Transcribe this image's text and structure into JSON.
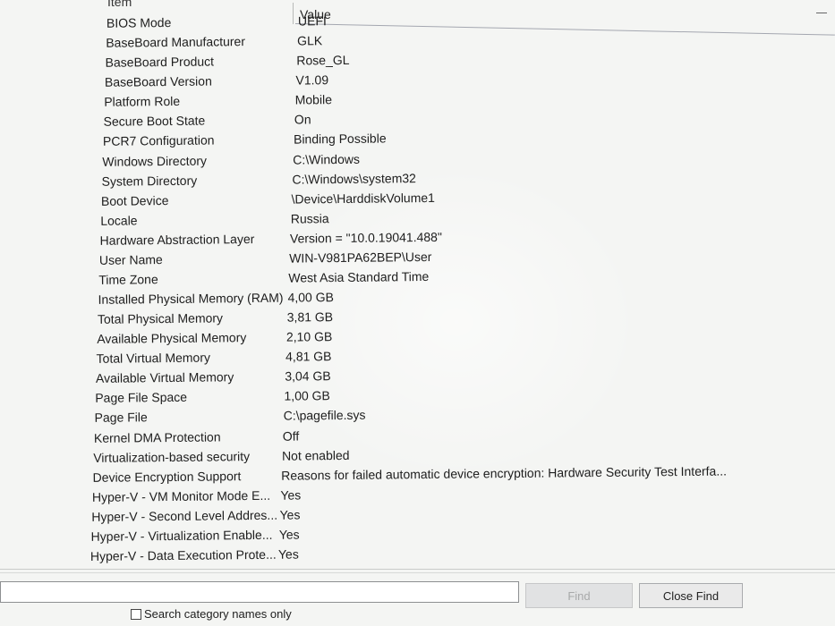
{
  "table": {
    "header_item": "Item",
    "header_value": "Value",
    "rows": [
      {
        "item": "BIOS Mode",
        "value": "UEFI"
      },
      {
        "item": "BaseBoard Manufacturer",
        "value": "GLK"
      },
      {
        "item": "BaseBoard Product",
        "value": "Rose_GL"
      },
      {
        "item": "BaseBoard Version",
        "value": "V1.09"
      },
      {
        "item": "Platform Role",
        "value": "Mobile"
      },
      {
        "item": "Secure Boot State",
        "value": "On"
      },
      {
        "item": "PCR7 Configuration",
        "value": "Binding Possible"
      },
      {
        "item": "Windows Directory",
        "value": "C:\\Windows"
      },
      {
        "item": "System Directory",
        "value": "C:\\Windows\\system32"
      },
      {
        "item": "Boot Device",
        "value": "\\Device\\HarddiskVolume1"
      },
      {
        "item": "Locale",
        "value": "Russia"
      },
      {
        "item": "Hardware Abstraction Layer",
        "value": "Version = \"10.0.19041.488\""
      },
      {
        "item": "User Name",
        "value": "WIN-V981PA62BEP\\User"
      },
      {
        "item": "Time Zone",
        "value": "West Asia Standard Time"
      },
      {
        "item": "Installed Physical Memory (RAM)",
        "value": "4,00 GB"
      },
      {
        "item": "Total Physical Memory",
        "value": "3,81 GB"
      },
      {
        "item": "Available Physical Memory",
        "value": "2,10 GB"
      },
      {
        "item": "Total Virtual Memory",
        "value": "4,81 GB"
      },
      {
        "item": "Available Virtual Memory",
        "value": "3,04 GB"
      },
      {
        "item": "Page File Space",
        "value": "1,00 GB"
      },
      {
        "item": "Page File",
        "value": "C:\\pagefile.sys"
      },
      {
        "item": "Kernel DMA Protection",
        "value": "Off"
      },
      {
        "item": "Virtualization-based security",
        "value": "Not enabled"
      },
      {
        "item": "Device Encryption Support",
        "value": "Reasons for failed automatic device encryption: Hardware Security Test Interfa..."
      },
      {
        "item": "Hyper-V - VM Monitor Mode E...",
        "value": "Yes"
      },
      {
        "item": "Hyper-V - Second Level Addres...",
        "value": "Yes"
      },
      {
        "item": "Hyper-V - Virtualization Enable...",
        "value": "Yes"
      },
      {
        "item": "Hyper-V - Data Execution Prote...",
        "value": "Yes"
      }
    ]
  },
  "find_bar": {
    "search_value": "",
    "find_label": "Find",
    "close_find_label": "Close Find",
    "checkbox_label": "Search category names only",
    "checkbox_checked": false
  }
}
